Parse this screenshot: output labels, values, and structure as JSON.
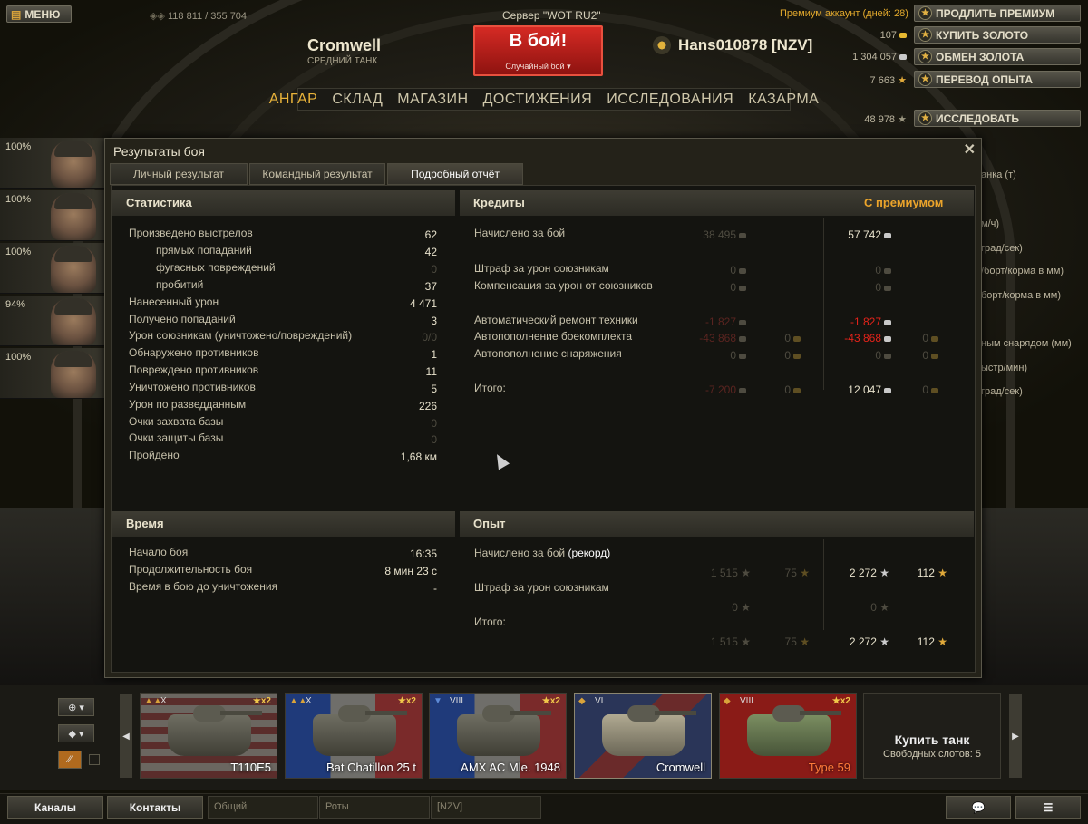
{
  "topbar": {
    "menu_label": "МЕНЮ",
    "xp_progress": "118 811 / 355 704",
    "server": "Сервер \"WOT RU2\"",
    "tank_name": "Cromwell",
    "tank_class": "СРЕДНИЙ ТАНК",
    "battle_button": "В бой!",
    "battle_mode": "Случайный бой",
    "player_name": "Hans010878 [NZV]",
    "premium_text": "Премиум аккаунт (дней: 28)",
    "gold": "107",
    "credits": "1 304 057",
    "free_xp": "7 663",
    "tank_xp": "48 978",
    "buttons": {
      "extend_premium": "ПРОДЛИТЬ ПРЕМИУМ",
      "buy_gold": "КУПИТЬ ЗОЛОТО",
      "exchange_gold": "ОБМЕН ЗОЛОТА",
      "convert_xp": "ПЕРЕВОД ОПЫТА",
      "research": "ИССЛЕДОВАТЬ"
    },
    "nav": [
      "АНГАР",
      "СКЛАД",
      "МАГАЗИН",
      "ДОСТИЖЕНИЯ",
      "ИССЛЕДОВАНИЯ",
      "КАЗАРМА"
    ]
  },
  "crew": [
    "100%",
    "100%",
    "100%",
    "94%",
    "100%"
  ],
  "right_side": [
    "анка (т)",
    "м/ч)",
    "град/сек)",
    "/борт/корма в мм)",
    "борт/корма в мм)",
    "ным снарядом (мм)",
    "ыстр/мин)",
    "град/сек)"
  ],
  "dialog": {
    "title": "Результаты боя",
    "tabs": [
      "Личный результат",
      "Командный результат",
      "Подробный отчёт"
    ],
    "stats": {
      "header": "Статистика",
      "rows": [
        {
          "label": "Произведено выстрелов",
          "value": "62"
        },
        {
          "label": "прямых попаданий",
          "value": "42"
        },
        {
          "label": "фугасных повреждений",
          "value": "0"
        },
        {
          "label": "пробитий",
          "value": "37"
        },
        {
          "label": "Нанесенный урон",
          "value": "4 471"
        },
        {
          "label": "Получено попаданий",
          "value": "3"
        },
        {
          "label": "Урон союзникам (уничтожено/повреждений)",
          "value": "0/0"
        },
        {
          "label": "Обнаружено противников",
          "value": "1"
        },
        {
          "label": "Повреждено противников",
          "value": "11"
        },
        {
          "label": "Уничтожено противников",
          "value": "5"
        },
        {
          "label": "Урон по разведданным",
          "value": "226"
        },
        {
          "label": "Очки захвата базы",
          "value": "0"
        },
        {
          "label": "Очки защиты базы",
          "value": "0"
        },
        {
          "label": "Пройдено",
          "value": "1,68 км"
        }
      ]
    },
    "credits": {
      "header": "Кредиты",
      "premium_header": "С премиумом",
      "rows": [
        {
          "label": "Начислено за бой",
          "base": "38 495",
          "base_gold": "",
          "prem": "57 742",
          "prem_gold": ""
        },
        {
          "label": "Штраф за урон союзникам",
          "base": "0",
          "base_gold": "",
          "prem": "0",
          "prem_gold": ""
        },
        {
          "label": "Компенсация за урон от союзников",
          "base": "0",
          "base_gold": "",
          "prem": "0",
          "prem_gold": ""
        },
        {
          "label": "Автоматический ремонт техники",
          "base": "-1 827",
          "base_gold": "",
          "prem": "-1 827",
          "prem_gold": ""
        },
        {
          "label": "Автопополнение боекомплекта",
          "base": "-43 868",
          "base_gold": "0",
          "prem": "-43 868",
          "prem_gold": "0"
        },
        {
          "label": "Автопополнение снаряжения",
          "base": "0",
          "base_gold": "0",
          "prem": "0",
          "prem_gold": "0"
        },
        {
          "label": "Итого:",
          "base": "-7 200",
          "base_gold": "0",
          "prem": "12 047",
          "prem_gold": "0"
        }
      ]
    },
    "time": {
      "header": "Время",
      "rows": [
        {
          "label": "Начало боя",
          "value": "16:35"
        },
        {
          "label": "Продолжительность боя",
          "value": "8 мин 23 с"
        },
        {
          "label": "Время в бою до уничтожения",
          "value": "-"
        }
      ]
    },
    "xp": {
      "header": "Опыт",
      "earned_label": "Начислено за бой",
      "record": "(рекорд)",
      "earned": {
        "base": "1 515",
        "base_free": "75",
        "prem": "2 272",
        "prem_free": "112"
      },
      "penalty_label": "Штраф за урон союзникам",
      "penalty": {
        "base": "0",
        "prem": "0"
      },
      "total_label": "Итого:",
      "total": {
        "base": "1 515",
        "base_free": "75",
        "prem": "2 272",
        "prem_free": "112"
      }
    }
  },
  "vehicles": [
    {
      "tier": "X",
      "name": "T110E5",
      "x2": "x2"
    },
    {
      "tier": "X",
      "name": "Bat Chatillon 25 t",
      "x2": "x2"
    },
    {
      "tier": "VIII",
      "name": "AMX AC Mle. 1948",
      "x2": "x2"
    },
    {
      "tier": "VI",
      "name": "Cromwell",
      "x2": ""
    },
    {
      "tier": "VIII",
      "name": "Type 59",
      "x2": "x2"
    }
  ],
  "buy_tank": {
    "title": "Купить танк",
    "slots": "Свободных слотов: 5"
  },
  "bottom": {
    "channels": "Каналы",
    "contacts": "Контакты",
    "fields": [
      "Общий",
      "Роты",
      "[NZV]"
    ]
  }
}
